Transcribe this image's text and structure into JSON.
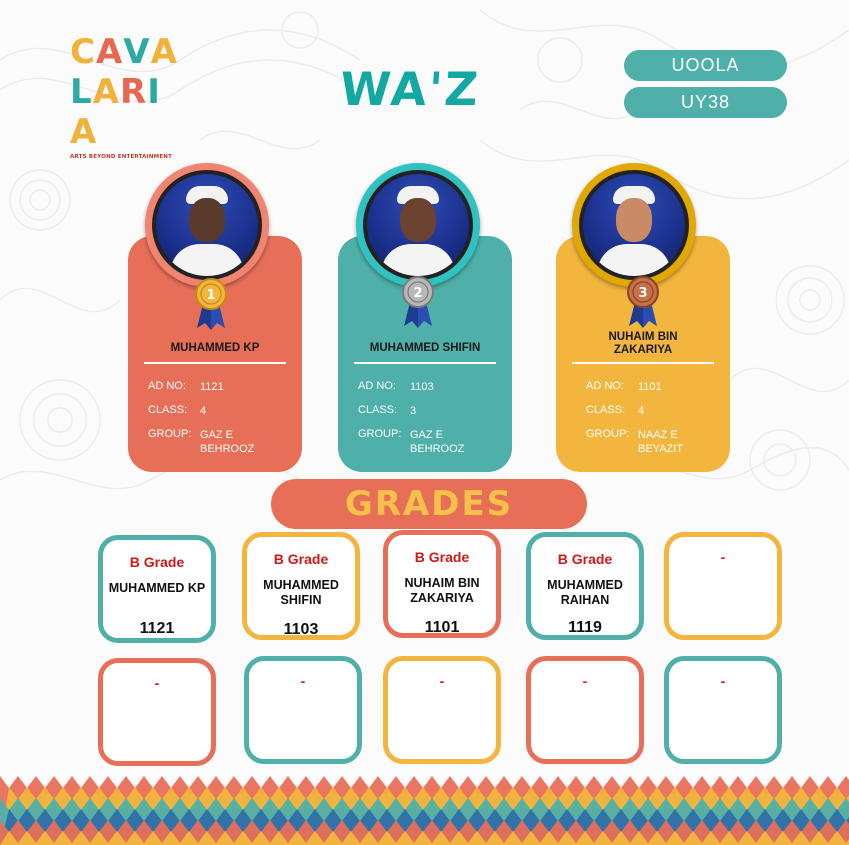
{
  "logo": {
    "letters_line1": [
      "C",
      "A",
      "V",
      "A"
    ],
    "letters_line2": [
      "L",
      "A",
      "R",
      "I",
      "A"
    ],
    "tagline": "ARTS BEYOND ENTERTAINMENT",
    "colors": [
      "#f0b23a",
      "#2fa9a3",
      "#e8674f",
      "#f0b23a",
      "#e8674f"
    ]
  },
  "title": "WA'Z",
  "badges": [
    "UOOLA",
    "UY38"
  ],
  "colors": {
    "coral": "#e86f57",
    "teal": "#4fb0a9",
    "gold": "#f2b53e",
    "red_text": "#d01818",
    "title_teal": "#14a8a3"
  },
  "winners": [
    {
      "rank": "1",
      "medal": "gold-medal-icon",
      "name": "MUHAMMED KP",
      "ad_no_label": "AD NO:",
      "ad_no": "1121",
      "class_label": "CLASS:",
      "class": "4",
      "group_label": "GROUP:",
      "group": "GAZ E BEHROOZ"
    },
    {
      "rank": "2",
      "medal": "silver-medal-icon",
      "name": "MUHAMMED SHIFIN",
      "ad_no_label": "AD NO:",
      "ad_no": "1103",
      "class_label": "CLASS:",
      "class": "3",
      "group_label": "GROUP:",
      "group": "GAZ E BEHROOZ"
    },
    {
      "rank": "3",
      "medal": "bronze-medal-icon",
      "name": "NUHAIM BIN ZAKARIYA",
      "ad_no_label": "AD NO:",
      "ad_no": "1101",
      "class_label": "CLASS:",
      "class": "4",
      "group_label": "GROUP:",
      "group": "NAAZ E BEYAZIT"
    }
  ],
  "grades_title": "GRADES",
  "grades": [
    {
      "grade": "B Grade",
      "name": "MUHAMMED KP",
      "ad_no": "1121"
    },
    {
      "grade": "B Grade",
      "name": "MUHAMMED SHIFIN",
      "ad_no": "1103"
    },
    {
      "grade": "B Grade",
      "name": "NUHAIM BIN ZAKARIYA",
      "ad_no": "1101"
    },
    {
      "grade": "B Grade",
      "name": "MUHAMMED RAIHAN",
      "ad_no": "1119"
    },
    {
      "grade": "-",
      "name": "",
      "ad_no": ""
    },
    {
      "grade": "-",
      "name": "",
      "ad_no": ""
    },
    {
      "grade": "-",
      "name": "",
      "ad_no": ""
    },
    {
      "grade": "-",
      "name": "",
      "ad_no": ""
    },
    {
      "grade": "-",
      "name": "",
      "ad_no": ""
    },
    {
      "grade": "-",
      "name": "",
      "ad_no": ""
    }
  ]
}
